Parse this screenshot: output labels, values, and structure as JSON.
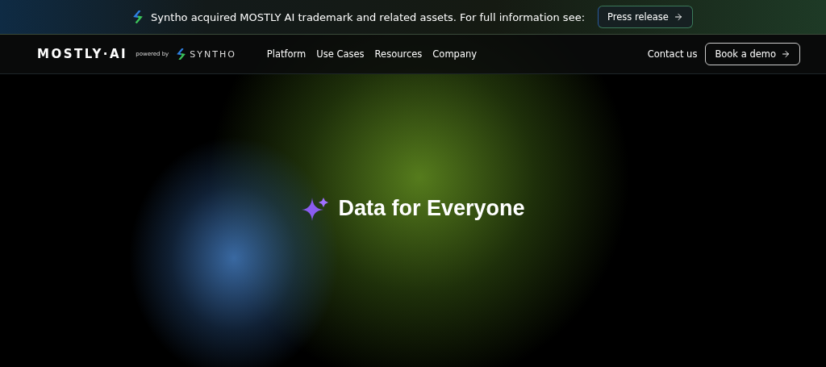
{
  "announcement": {
    "text": "Syntho acquired MOSTLY AI trademark and related assets. For full information see:",
    "button": "Press release"
  },
  "header": {
    "logo": "MOSTLY·AI",
    "powered_by": "powered by",
    "partner": "SYNTHO",
    "nav": [
      "Platform",
      "Use Cases",
      "Resources",
      "Company"
    ],
    "contact": "Contact us",
    "cta": "Book a demo"
  },
  "hero": {
    "title": "Data for Everyone"
  }
}
